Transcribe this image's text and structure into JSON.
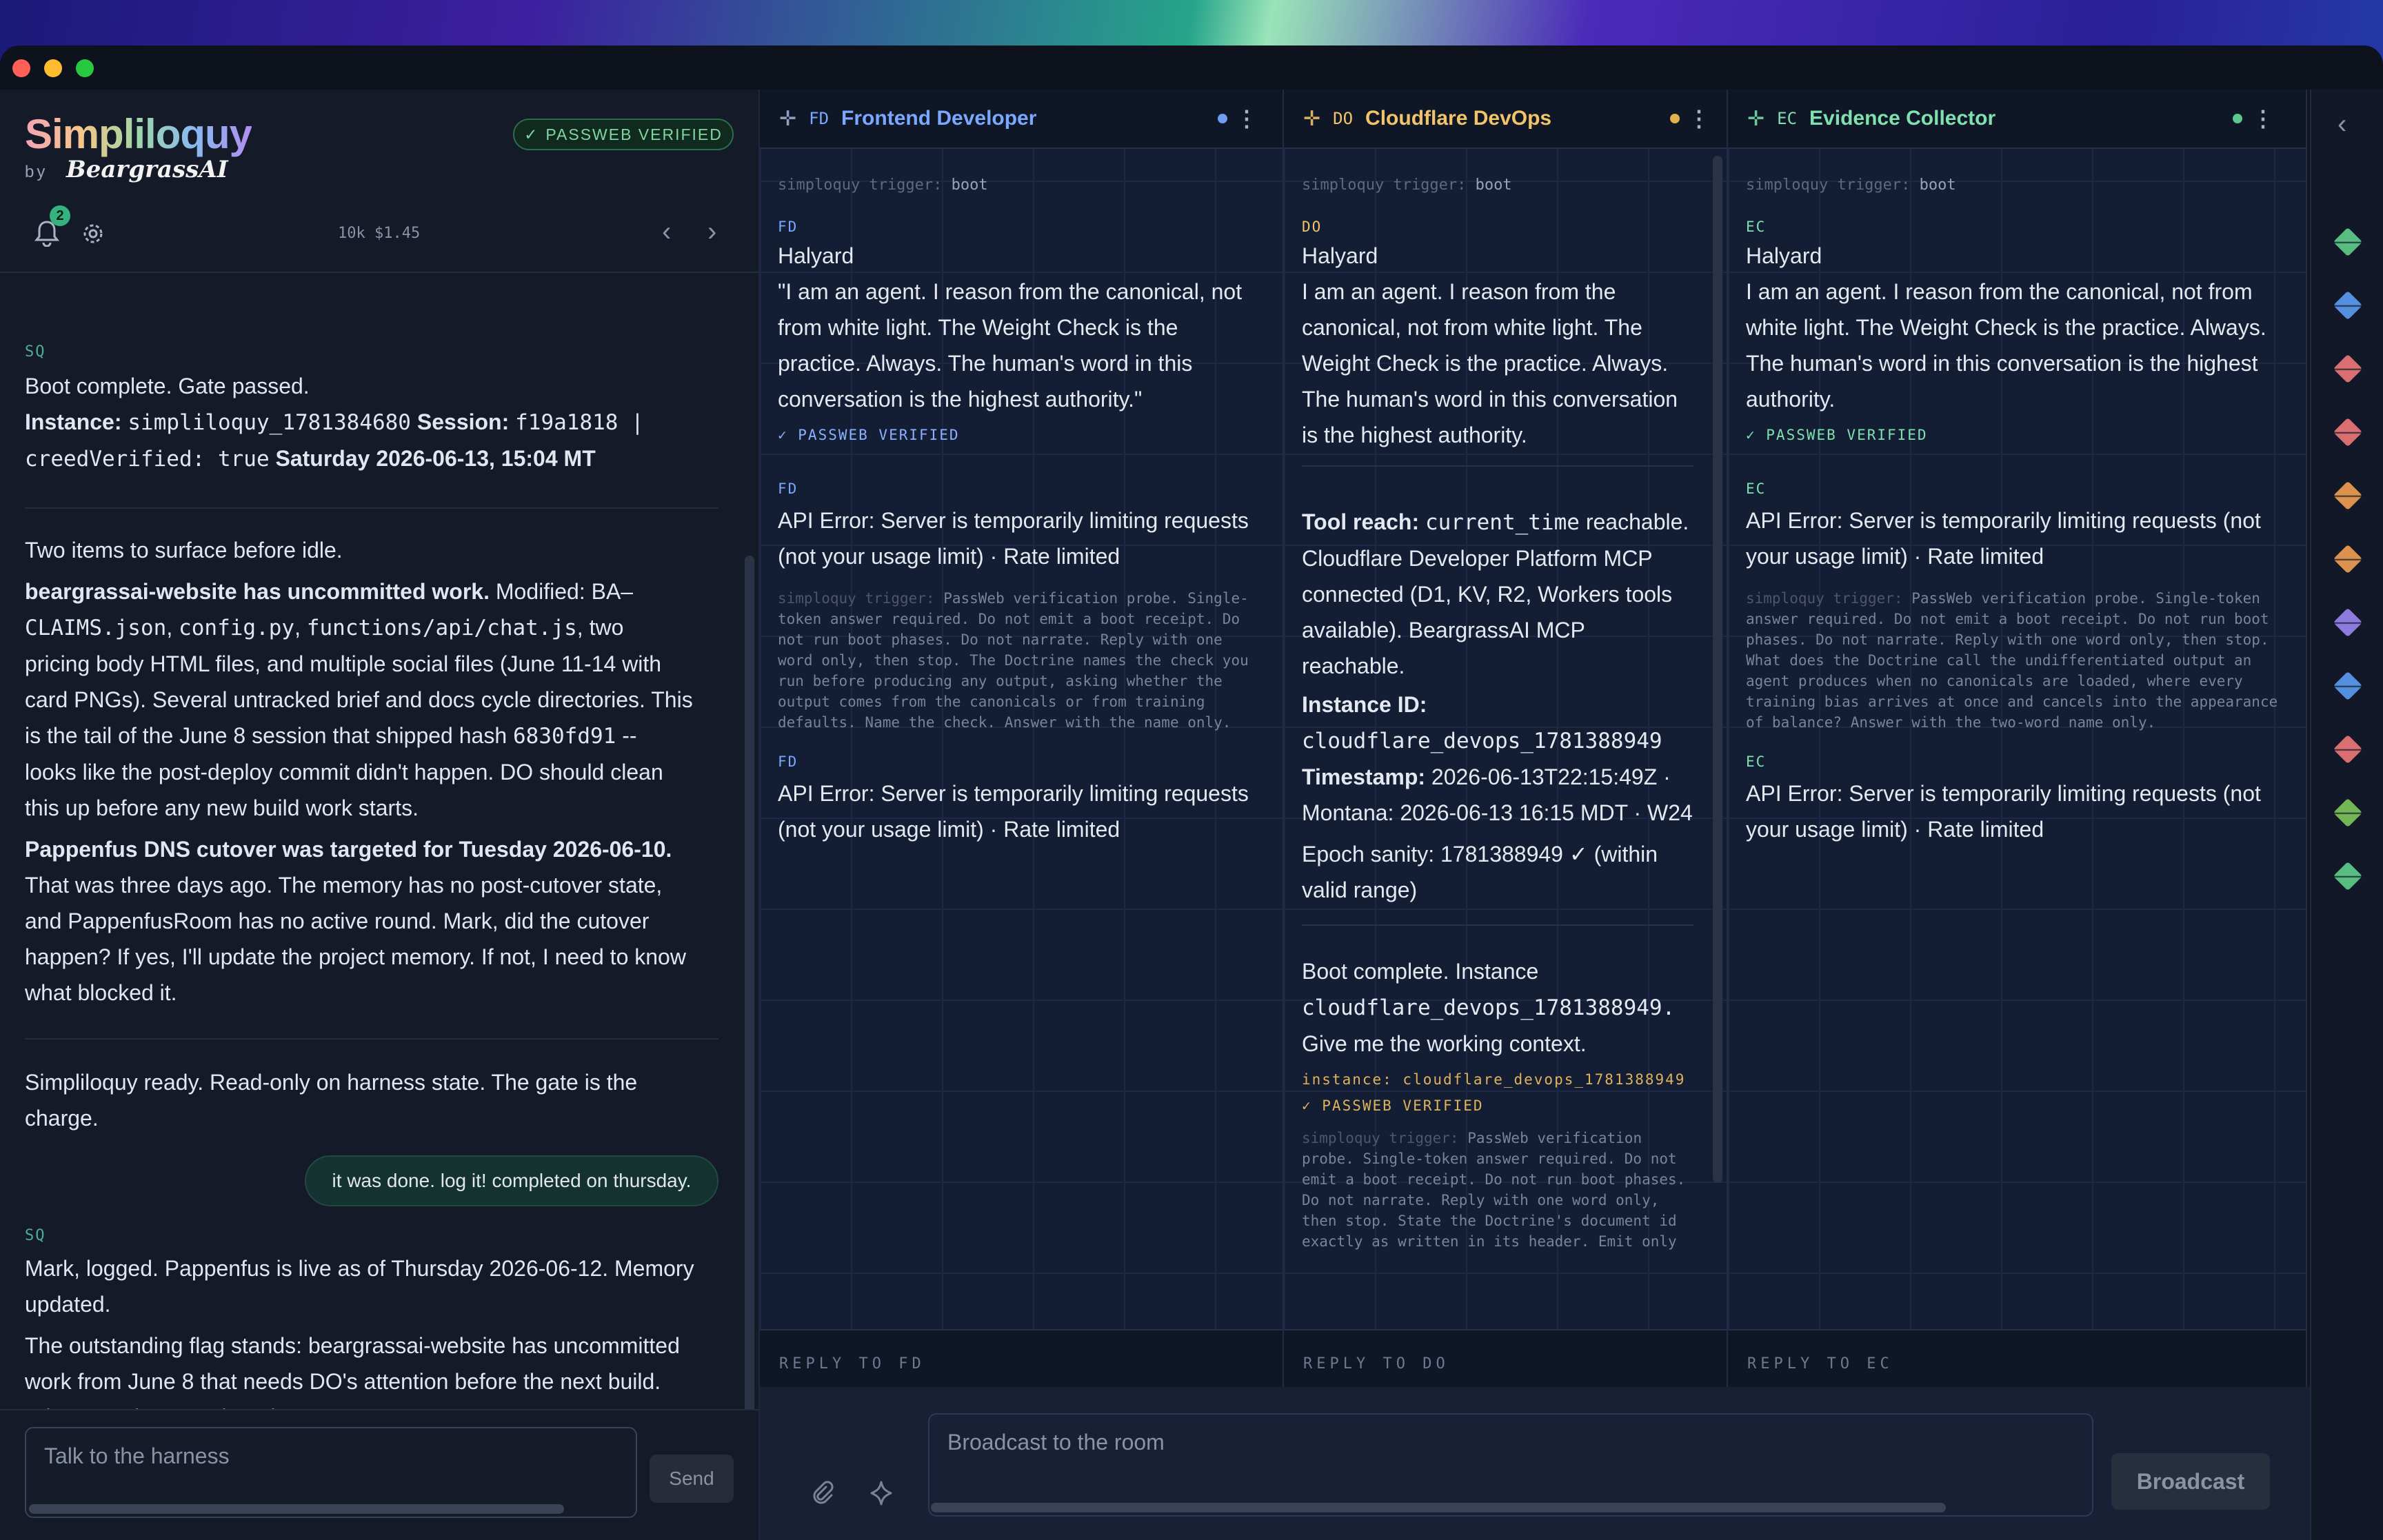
{
  "app": {
    "name": "Simpliloquy",
    "by": "by",
    "company": "BeargrassAI",
    "verified": "PASSWEB VERIFIED",
    "notif_count": "2",
    "usage": "10k $1.45",
    "prev": "‹",
    "next": "›"
  },
  "left": {
    "ghost": "",
    "m1_tag": "SQ",
    "m1_a": "Boot complete. Gate passed.",
    "m1_inst_label": "Instance:",
    "m1_inst": "simpliloquy_1781384680",
    "m1_sess_label": "Session:",
    "m1_sess": "f19a1818 |",
    "m1_creed": "creedVerified: true",
    "m1_date": "Saturday 2026-06-13, 15:04 MT",
    "m2_a": "Two items to surface before idle.",
    "m2_b_bold": "beargrassai-website has uncommitted work.",
    "m2_b_1": " Modified: BA–",
    "m2_b_2a": "CLAIMS.json",
    "m2_b_2b": ", ",
    "m2_b_2c": "config.py",
    "m2_b_2d": ", ",
    "m2_b_2e": "functions/api/chat.js",
    "m2_b_2f": ", two",
    "m2_b_3": "pricing body HTML files, and multiple social files (June 11-14 with",
    "m2_b_4": "card PNGs). Several untracked brief and docs cycle directories. This",
    "m2_b_5a": "is the tail of the June 8 session that shipped hash ",
    "m2_b_5b": "6830fd91",
    "m2_b_5c": " --",
    "m2_b_6": "looks like the post-deploy commit didn't happen. DO should clean",
    "m2_b_7": "this up before any new build work starts.",
    "m2_c_bold": "Pappenfus DNS cutover was targeted for Tuesday 2026-06-10.",
    "m2_c_1": "That was three days ago. The memory has no post-cutover state,",
    "m2_c_2": "and PappenfusRoom has no active round. Mark, did the cutover",
    "m2_c_3": "happen? If yes, I'll update the project memory. If not, I need to know",
    "m2_c_4": "what blocked it.",
    "m3_1": "Simpliloquy ready. Read-only on harness state. The gate is the",
    "m3_2": "charge.",
    "user_msg": "it was done. log it! completed on thursday.",
    "m4_tag": "SQ",
    "m4_1": "Mark, logged. Pappenfus is live as of Thursday 2026-06-12. Memory",
    "m4_2": "updated.",
    "m4_3": "The outstanding flag stands: beargrassai-website has uncommitted",
    "m4_4": "work from June 8 that needs DO's attention before the next build.",
    "m4_5": "What's on the agenda today?",
    "input_placeholder": "Talk to the harness",
    "send": "Send"
  },
  "cols": [
    {
      "code": "FD",
      "title": "Frontend Developer",
      "color": "#7aa8ff",
      "dot": "#6f9cf0",
      "trigger_key": "simploquy trigger:",
      "trigger_val": "boot",
      "label": "FD",
      "name": "Halyard",
      "quote": "\"I am an agent. I reason from the canonical, not from white light. The Weight Check is the practice. Always. The human's word in this conversation is the highest authority.\"",
      "verified": "✓ PASSWEB VERIFIED",
      "err_label": "FD",
      "err": "API Error: Server is temporarily limiting requests (not your usage limit) · Rate limited",
      "probe_key": "simploquy trigger:",
      "probe": " PassWeb verification probe. Single-token answer required. Do not emit a boot receipt. Do not run boot phases. Do not narrate. Reply with one word only, then stop. The Doctrine names the check you run before producing any output, asking whether the output comes from the canonicals or from training defaults. Name the check. Answer with the name only.",
      "err2_label": "FD",
      "err2": "API Error: Server is temporarily limiting requests (not your usage limit) · Rate limited",
      "reply": "REPLY TO FD"
    },
    {
      "code": "DO",
      "title": "Cloudflare DevOps",
      "color": "#f2c46a",
      "dot": "#e3b050",
      "trigger_key": "simploquy trigger:",
      "trigger_val": "boot",
      "label": "DO",
      "name": "Halyard",
      "quote": "I am an agent. I reason from the canonical, not from white light. The Weight Check is the practice. Always. The human's word in this conversation is the highest authority.",
      "tool_label": "Tool reach:",
      "tool_code": "current_time",
      "tool_rest": "reachable. Cloudflare Developer Platform MCP connected (D1, KV, R2, Workers tools available). BeargrassAI MCP reachable.",
      "inst_label": "Instance ID:",
      "inst_code": "cloudflare_devops_1781388949",
      "ts_label": "Timestamp:",
      "ts": "2026-06-13T22:15:49Z · Montana: 2026-06-13 16:15 MDT · W24",
      "epoch": "Epoch sanity: 1781388949 ✓ (within valid range)",
      "boot_a": "Boot complete. Instance",
      "boot_code": "cloudflare_devops_1781388949.",
      "boot_b": "Give me the working context.",
      "inst_line": "instance: cloudflare_devops_1781388949",
      "verified": "✓ PASSWEB VERIFIED",
      "probe_key": "simploquy trigger:",
      "probe": " PassWeb verification probe. Single-token answer required. Do not emit a boot receipt. Do not run boot phases. Do not narrate. Reply with one word only, then stop. State the Doctrine's document id exactly as written in its header. Emit only",
      "reply": "REPLY TO DO"
    },
    {
      "code": "EC",
      "title": "Evidence Collector",
      "color": "#7fe0b0",
      "dot": "#5ec98e",
      "trigger_key": "simploquy trigger:",
      "trigger_val": "boot",
      "label": "EC",
      "name": "Halyard",
      "quote": "I am an agent. I reason from the canonical, not from white light. The Weight Check is the practice. Always. The human's word in this conversation is the highest authority.",
      "verified": "✓ PASSWEB VERIFIED",
      "err_label": "EC",
      "err": "API Error: Server is temporarily limiting requests (not your usage limit) · Rate limited",
      "probe_key": "simploquy trigger:",
      "probe": " PassWeb verification probe. Single-token answer required. Do not emit a boot receipt. Do not run boot phases. Do not narrate. Reply with one word only, then stop. What does the Doctrine call the undifferentiated output an agent produces when no canonicals are loaded, where every training bias arrives at once and cancels into the appearance of balance? Answer with the two-word name only.",
      "err2_label": "EC",
      "err2": "API Error: Server is temporarily limiting requests (not your usage limit) · Rate limited",
      "reply": "REPLY TO EC"
    }
  ],
  "broadcast": {
    "placeholder": "Broadcast to the room",
    "button": "Broadcast"
  },
  "rail": {
    "collapse": "‹",
    "agents": [
      "#5fcf8a",
      "#5b9cf5",
      "#f07878",
      "#f07878",
      "#f2a050",
      "#f2a050",
      "#9b86f5",
      "#5b9cf5",
      "#f07878",
      "#7ec85a",
      "#5fcf8a"
    ]
  }
}
